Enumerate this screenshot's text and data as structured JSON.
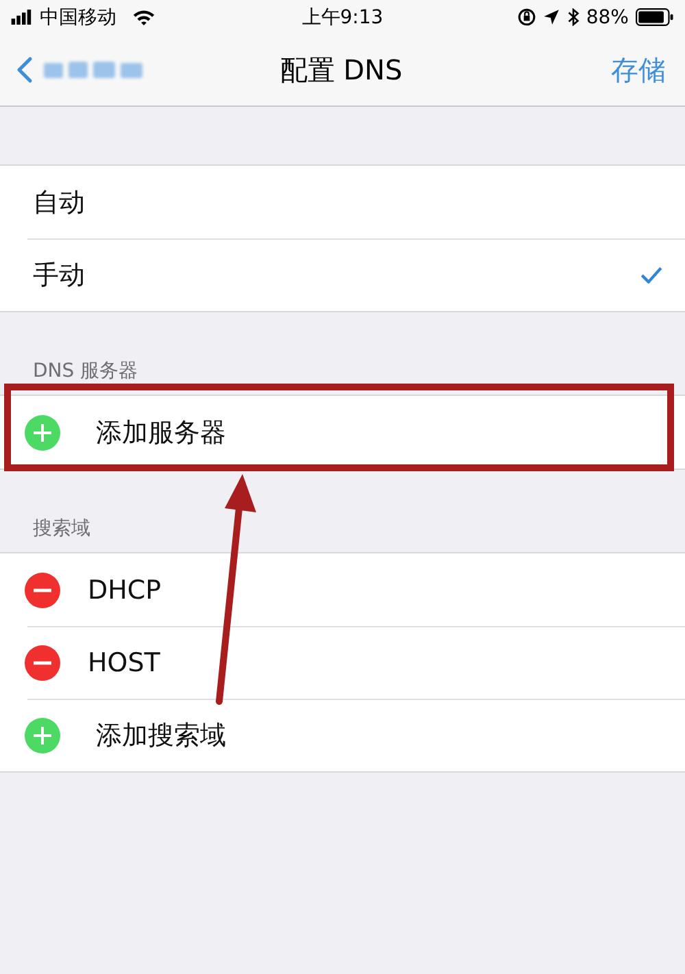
{
  "status_bar": {
    "carrier": "中国移动",
    "time": "上午9:13",
    "battery": "88%"
  },
  "nav": {
    "title": "配置 DNS",
    "action": "存储"
  },
  "mode_options": [
    {
      "label": "自动",
      "selected": false
    },
    {
      "label": "手动",
      "selected": true
    }
  ],
  "sections": [
    {
      "header": "DNS 服务器",
      "rows": [
        {
          "kind": "add",
          "label": "添加服务器",
          "highlighted": true
        }
      ]
    },
    {
      "header": "搜索域",
      "rows": [
        {
          "kind": "remove",
          "label": "DHCP",
          "highlighted": false
        },
        {
          "kind": "remove",
          "label": "HOST",
          "highlighted": false
        },
        {
          "kind": "add",
          "label": "添加搜索域",
          "highlighted": false
        }
      ]
    }
  ]
}
